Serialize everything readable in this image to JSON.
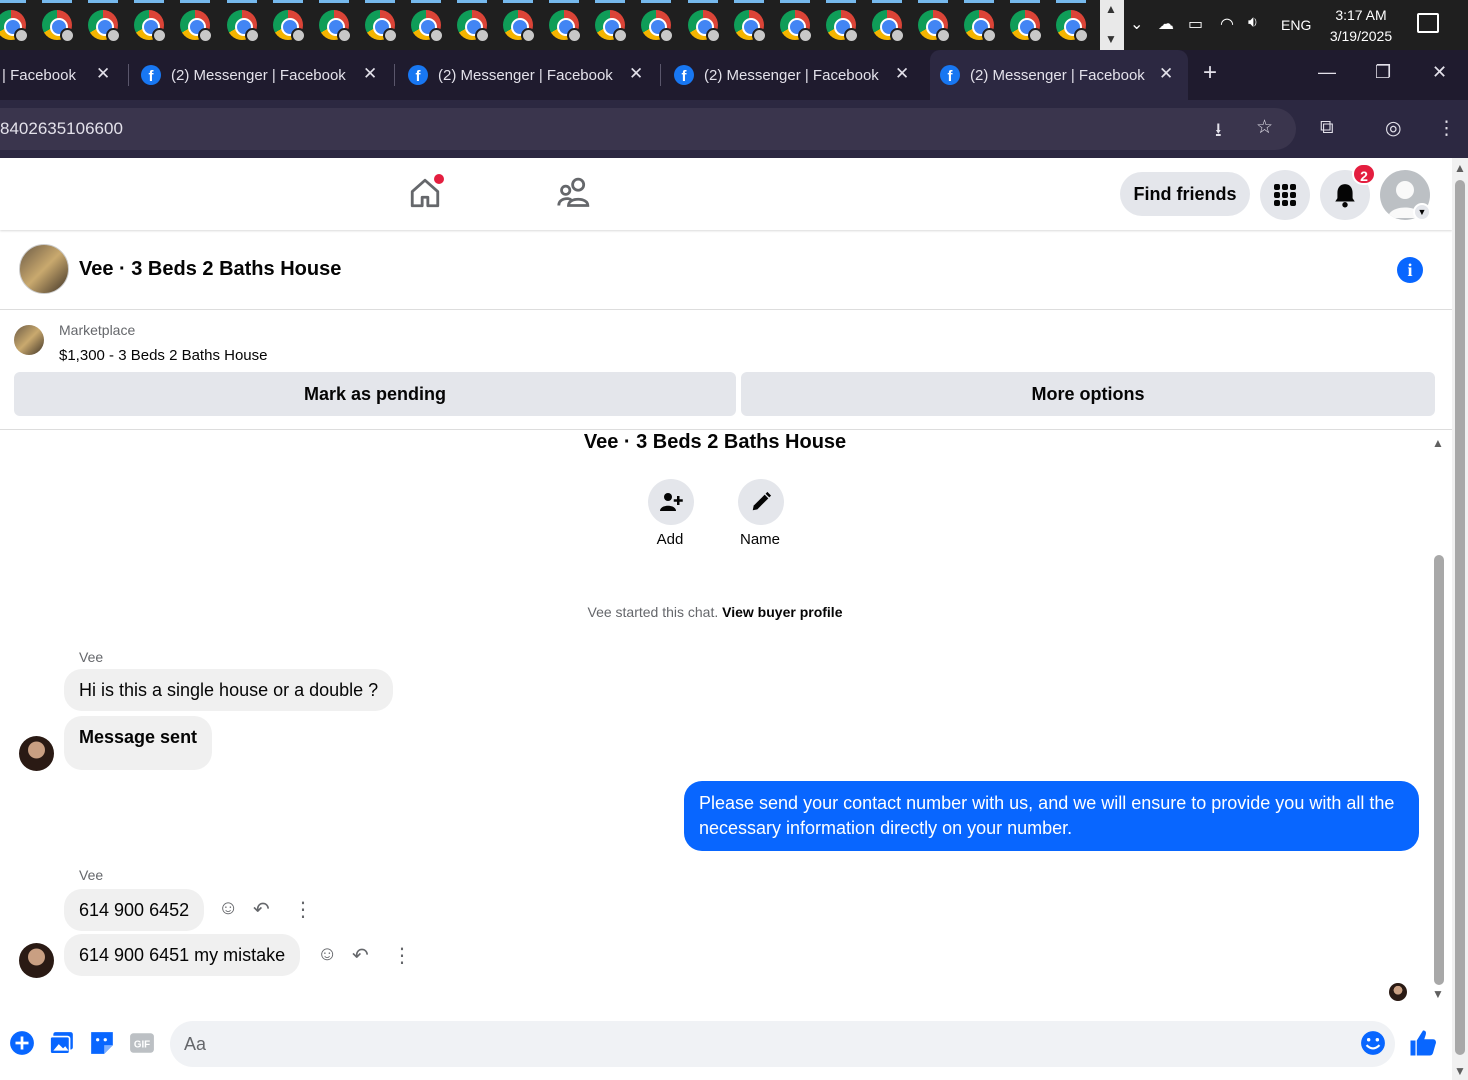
{
  "taskbar": {
    "app_count": 24,
    "tray": {
      "language": "ENG",
      "time": "3:17 AM",
      "date": "3/19/2025"
    }
  },
  "browser": {
    "tabs": [
      {
        "label": "| Facebook"
      },
      {
        "label": "(2) Messenger | Facebook"
      },
      {
        "label": "(2) Messenger | Facebook"
      },
      {
        "label": "(2) Messenger | Facebook"
      },
      {
        "label": "(2) Messenger | Facebook",
        "active": true
      }
    ],
    "url": "8402635106600"
  },
  "fb_header": {
    "find_friends_label": "Find friends",
    "notification_count": "2"
  },
  "conversation": {
    "title": "Vee · 3 Beds 2 Baths House",
    "marketplace": {
      "label": "Marketplace",
      "listing": "$1,300 - 3 Beds 2 Baths House",
      "mark_pending_label": "Mark as pending",
      "more_options_label": "More options"
    },
    "chat_title": "Vee · 3 Beds 2 Baths House",
    "actions": {
      "add_label": "Add",
      "name_label": "Name"
    },
    "started_text": "Vee started this chat.",
    "view_profile_label": "View buyer profile",
    "messages": [
      {
        "sender": "Vee",
        "text": "Hi is this a single house or a double ?"
      },
      {
        "text": "Message sent"
      },
      {
        "outgoing": true,
        "text": "Please send your contact number with us, and we will ensure to provide you with all the necessary information directly on your number."
      },
      {
        "sender": "Vee",
        "text": "614 900 6452"
      },
      {
        "text": "614 900 6451 my mistake"
      }
    ]
  },
  "composer": {
    "placeholder": "Aa"
  },
  "colors": {
    "fb_blue": "#0866ff",
    "bubble_in": "#f0f0f0",
    "notif_red": "#e41e3f"
  }
}
